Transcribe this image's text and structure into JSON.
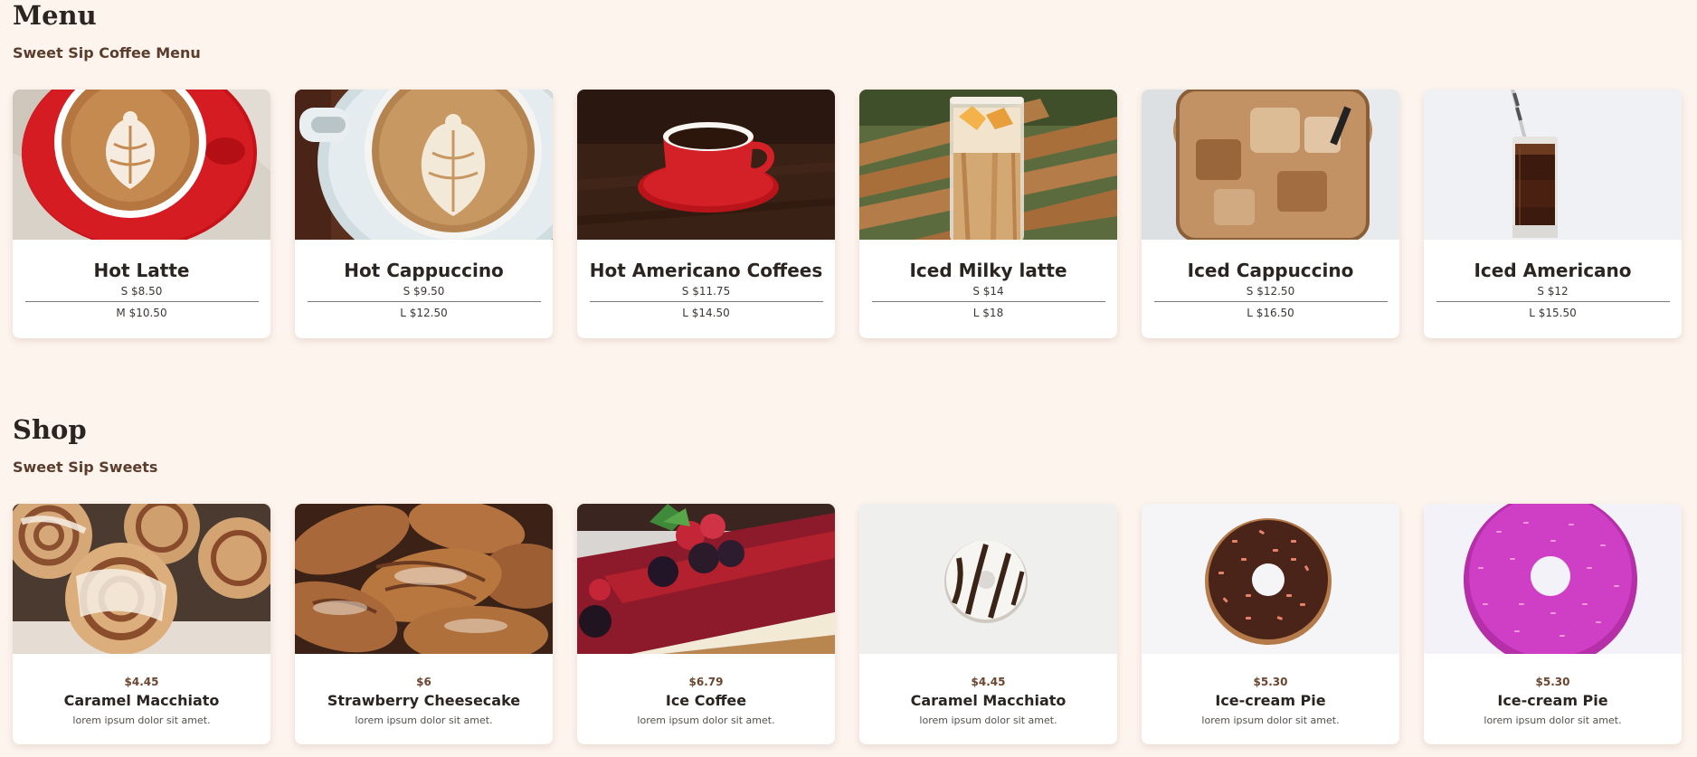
{
  "menu": {
    "title": "Menu",
    "subtitle": "Sweet Sip Coffee Menu",
    "items": [
      {
        "name": "Hot Latte",
        "price1": "S $8.50",
        "price2": "M $10.50",
        "image": "latte-art-red-cup-image"
      },
      {
        "name": "Hot Cappuccino",
        "price1": "S $9.50",
        "price2": "L $12.50",
        "image": "cappuccino-white-cup-image"
      },
      {
        "name": "Hot Americano Coffees",
        "price1": "S $11.75",
        "price2": "L $14.50",
        "image": "red-espresso-cup-image"
      },
      {
        "name": "Iced Milky latte",
        "price1": "S $14",
        "price2": "L $18",
        "image": "iced-latte-glass-image"
      },
      {
        "name": "Iced Cappuccino",
        "price1": "S $12.50",
        "price2": "L $16.50",
        "image": "iced-cappuccino-glass-image"
      },
      {
        "name": "Iced Americano",
        "price1": "S $12",
        "price2": "L $15.50",
        "image": "iced-americano-glass-image"
      }
    ]
  },
  "shop": {
    "title": "Shop",
    "subtitle": "Sweet Sip Sweets",
    "items": [
      {
        "price": "$4.45",
        "name": "Caramel Macchiato",
        "desc": "lorem ipsum dolor sit amet.",
        "image": "cinnamon-rolls-image"
      },
      {
        "price": "$6",
        "name": "Strawberry Cheesecake",
        "desc": "lorem ipsum dolor sit amet.",
        "image": "croissants-image"
      },
      {
        "price": "$6.79",
        "name": "Ice Coffee",
        "desc": "lorem ipsum dolor sit amet.",
        "image": "berry-cheesecake-image"
      },
      {
        "price": "$4.45",
        "name": "Caramel Macchiato",
        "desc": "lorem ipsum dolor sit amet.",
        "image": "white-donut-image"
      },
      {
        "price": "$5.30",
        "name": "Ice-cream Pie",
        "desc": "lorem ipsum dolor sit amet.",
        "image": "chocolate-donut-image"
      },
      {
        "price": "$5.30",
        "name": "Ice-cream Pie",
        "desc": "lorem ipsum dolor sit amet.",
        "image": "pink-donut-image"
      }
    ]
  },
  "colors": {
    "background": "#fdf4ee",
    "subtitle": "#5a3d2c",
    "price_accent": "#6b4530"
  }
}
